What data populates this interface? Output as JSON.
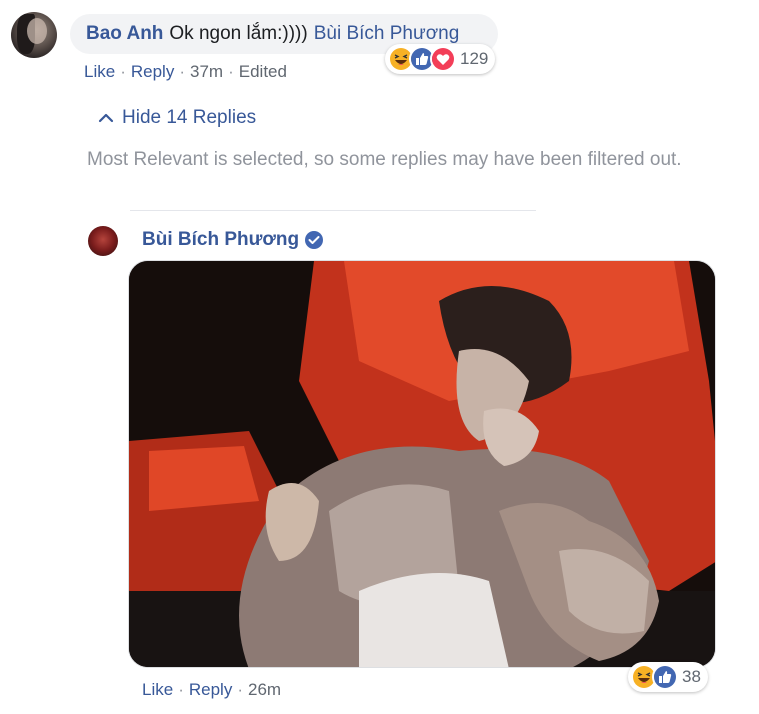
{
  "comment": {
    "author": "Bao Anh",
    "text": "Ok ngon lắm:))))",
    "tag": "Bùi Bích Phương",
    "reactions": {
      "icons": [
        "haha-icon",
        "like-icon",
        "love-icon"
      ],
      "count": "129"
    },
    "actions": {
      "like": "Like",
      "reply": "Reply",
      "time": "37m",
      "edited": "Edited"
    }
  },
  "replies_toggle": {
    "label": "Hide 14 Replies",
    "icon": "chevron-up-icon"
  },
  "filter_note": "Most Relevant is selected, so some replies may have been filtered out.",
  "reply": {
    "author": "Bùi Bích Phương",
    "verified_icon": "verified-badge-icon",
    "media": "gif-image",
    "reactions": {
      "icons": [
        "haha-icon",
        "like-icon"
      ],
      "count": "38"
    },
    "actions": {
      "like": "Like",
      "reply": "Reply",
      "time": "26m"
    }
  },
  "colors": {
    "link": "#385898",
    "muted": "#606770",
    "bubble": "#f2f3f5",
    "like_blue": "#4267b2",
    "love_red": "#f33e58",
    "haha_yellow": "#f7b125"
  }
}
